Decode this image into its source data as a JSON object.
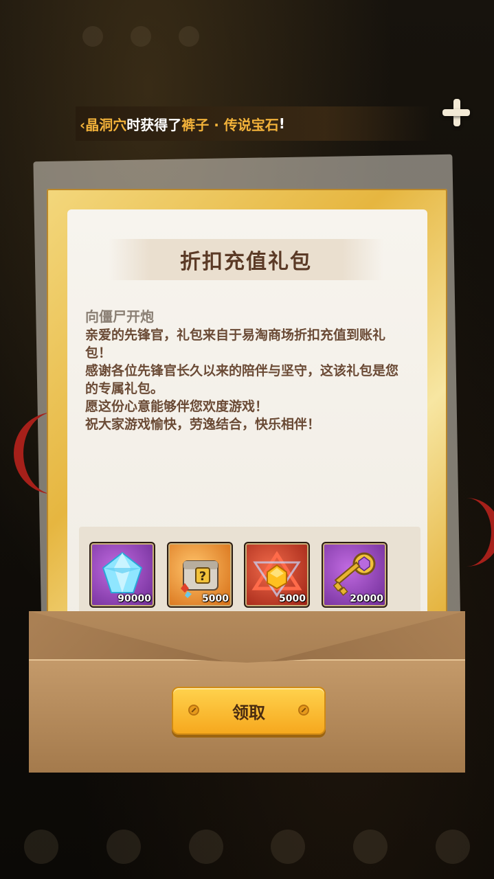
{
  "ticker": {
    "prefix": "‹晶洞穴",
    "mid": "时获得了",
    "item": "裤子 · 传说宝石",
    "suffix": "!"
  },
  "mail": {
    "title": "折扣充值礼包",
    "sender": "向僵尸开炮",
    "lines": [
      "亲爱的先锋官，礼包来自于易淘商场折扣充值到账礼包！",
      "感谢各位先锋官长久以来的陪伴与坚守，这该礼包是您的专属礼包。",
      "愿这份心意能够伴您欢度游戏！",
      "祝大家游戏愉快，劳逸结合，快乐相伴！"
    ]
  },
  "rewards": [
    {
      "icon": "diamond-icon",
      "qty": "90000",
      "rarity_color": "#8a3ab5"
    },
    {
      "icon": "mystery-chest-icon",
      "qty": "5000",
      "rarity_color": "#e08a1e"
    },
    {
      "icon": "gem-core-icon",
      "qty": "5000",
      "rarity_color": "#b82a18"
    },
    {
      "icon": "key-icon",
      "qty": "20000",
      "rarity_color": "#8a3ab5"
    }
  ],
  "claim_button": {
    "label": "领取"
  }
}
